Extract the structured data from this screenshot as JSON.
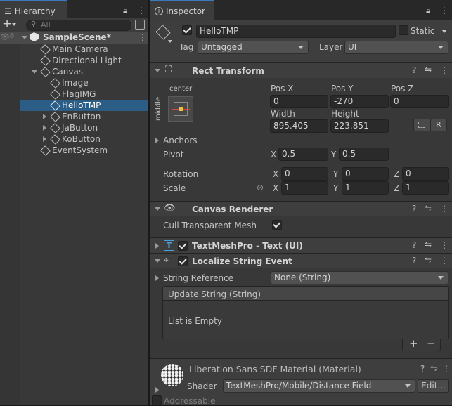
{
  "hierarchy": {
    "tab_label": "Hierarchy",
    "add_label": "+",
    "search_placeholder": "All",
    "scene": "SampleScene*",
    "items": [
      {
        "label": "Main Camera"
      },
      {
        "label": "Directional Light"
      },
      {
        "label": "Canvas"
      },
      {
        "label": "Image"
      },
      {
        "label": "FlagIMG"
      },
      {
        "label": "HelloTMP"
      },
      {
        "label": "EnButton"
      },
      {
        "label": "JaButton"
      },
      {
        "label": "KoButton"
      },
      {
        "label": "EventSystem"
      }
    ]
  },
  "inspector": {
    "tab_label": "Inspector",
    "object_name": "HelloTMP",
    "static_label": "Static",
    "tag_label": "Tag",
    "tag_value": "Untagged",
    "layer_label": "Layer",
    "layer_value": "UI",
    "rect_transform": {
      "title": "Rect Transform",
      "anchor_h": "center",
      "anchor_v": "middle",
      "pos_x_label": "Pos X",
      "pos_x": "0",
      "pos_y_label": "Pos Y",
      "pos_y": "-270",
      "pos_z_label": "Pos Z",
      "pos_z": "0",
      "width_label": "Width",
      "width": "895.405",
      "height_label": "Height",
      "height": "223.851",
      "r_label": "R",
      "anchors_label": "Anchors",
      "pivot_label": "Pivot",
      "pivot_x": "0.5",
      "pivot_y": "0.5",
      "rotation_label": "Rotation",
      "rot_x": "0",
      "rot_y": "0",
      "rot_z": "0",
      "scale_label": "Scale",
      "scale_x": "1",
      "scale_y": "1",
      "scale_z": "1",
      "x": "X",
      "y": "Y",
      "z": "Z"
    },
    "canvas_renderer": {
      "title": "Canvas Renderer",
      "cull_label": "Cull Transparent Mesh"
    },
    "textmeshpro": {
      "title": "TextMeshPro - Text (UI)"
    },
    "localize": {
      "title": "Localize String Event",
      "string_ref_label": "String Reference",
      "string_ref_value": "None (String)",
      "event_header": "Update String (String)",
      "list_empty": "List is Empty",
      "plus": "+",
      "minus": "−"
    },
    "material": {
      "title": "Liberation Sans SDF Material (Material)",
      "shader_label": "Shader",
      "shader_value": "TextMeshPro/Mobile/Distance Field",
      "edit_label": "Edit..."
    },
    "addressable_label": "Addressable"
  },
  "colors": {
    "selection": "#2c5d87",
    "panel": "#383838",
    "tab_accent": "#3a79bb"
  }
}
